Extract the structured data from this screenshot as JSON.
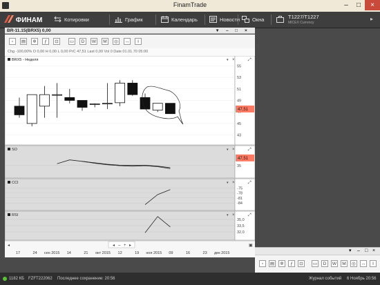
{
  "app": {
    "title": "FinamTrade"
  },
  "colors": {
    "accent": "#e9573f",
    "menubar": "#3e3e3e",
    "price_tag": "#ff7a63"
  },
  "menubar": {
    "logo": "ФИНАМ",
    "items": [
      {
        "label": "Котировки",
        "icon": "quotes-icon"
      },
      {
        "label": "График",
        "icon": "chart-icon"
      },
      {
        "label": "Календарь",
        "icon": "calendar-icon"
      },
      {
        "label": "Новости",
        "icon": "news-icon"
      },
      {
        "label": "Окна",
        "icon": "windows-icon"
      }
    ],
    "account": {
      "name": "T1227/T1227",
      "sub": "MICEX Currency"
    }
  },
  "chart_window": {
    "title": "BR-11.15(BRX5) 0,00",
    "toolbar_buttons": [
      "D",
      "W",
      "M"
    ],
    "info": "Chg -100,00%  O 0,00  H 0,00  L 0,00  PrC 47,51  Last 0,00  Vol 0  Date 01.01.70 05:00"
  },
  "lower_window": {
    "toolbar_buttons": [
      "D",
      "W",
      "M"
    ]
  },
  "chart_data": [
    {
      "type": "candlestick",
      "title": "BRX5 - Неделя",
      "y_ticks": [
        "55",
        "53",
        "51",
        "49",
        "47",
        "45",
        "43"
      ],
      "ylim": [
        42,
        56
      ],
      "last_price_label": "47,51",
      "candles": [
        {
          "o": 48.0,
          "h": 49.5,
          "l": 46.0,
          "c": 46.5
        },
        {
          "o": 45.0,
          "h": 49.5,
          "l": 44.5,
          "c": 50.0
        },
        {
          "o": 48.0,
          "h": 51.5,
          "l": 46.0,
          "c": 50.0
        },
        {
          "o": 50.0,
          "h": 52.0,
          "l": 46.0,
          "c": 50.0
        },
        {
          "o": 49.5,
          "h": 51.0,
          "l": 48.5,
          "c": 49.0
        },
        {
          "o": 49.0,
          "h": 49.0,
          "l": 47.2,
          "c": 47.8
        },
        {
          "o": 48.3,
          "h": 48.5,
          "l": 47.8,
          "c": 48.4
        },
        {
          "o": 48.5,
          "h": 52.0,
          "l": 47.5,
          "c": 48.5
        },
        {
          "o": 48.6,
          "h": 52.5,
          "l": 48.0,
          "c": 52.0
        },
        {
          "o": 52.0,
          "h": 52.5,
          "l": 49.8,
          "c": 50.0
        },
        {
          "o": 49.5,
          "h": 50.2,
          "l": 47.5,
          "c": 47.5
        },
        {
          "o": 47.3,
          "h": 48.5,
          "l": 47.0,
          "c": 48.5
        },
        {
          "o": 48.5,
          "h": 48.5,
          "l": 46.7,
          "c": 46.7
        }
      ]
    },
    {
      "type": "line",
      "title": "SO",
      "y_ticks": [
        "35"
      ],
      "ylim": [
        0,
        100
      ],
      "price_tag": "47,51",
      "series": [
        {
          "values": [
            null,
            null,
            null,
            42,
            58,
            52,
            44,
            38,
            34,
            32,
            34,
            30,
            22
          ]
        },
        {
          "values": [
            null,
            null,
            null,
            null,
            null,
            52,
            46,
            40,
            36,
            36,
            36,
            32,
            26
          ]
        }
      ]
    },
    {
      "type": "line",
      "title": "CCI",
      "y_ticks": [
        "-75",
        "-78",
        "-81",
        "-84"
      ],
      "ylim": [
        -86,
        -72
      ],
      "series": [
        {
          "values": [
            null,
            null,
            null,
            null,
            null,
            null,
            null,
            null,
            null,
            null,
            -85,
            -79,
            -76
          ]
        }
      ]
    },
    {
      "type": "line",
      "title": "RSI",
      "y_ticks": [
        "35,0",
        "33,5",
        "32,0"
      ],
      "ylim": [
        31.0,
        36.0
      ],
      "series": [
        {
          "values": [
            null,
            null,
            null,
            null,
            null,
            null,
            null,
            null,
            null,
            null,
            31.8,
            35.7,
            33.2
          ]
        }
      ]
    }
  ],
  "x_axis_labels": [
    "17",
    "24",
    "сен 2015",
    "14",
    "21",
    "окт 2015",
    "12",
    "19",
    "ноя 2015",
    "09",
    "16",
    "23",
    "дек 2015"
  ],
  "status": {
    "count": "1182 КБ",
    "account": "FZFT222062",
    "saved": "Последнее сохранение: 20:56",
    "journal": "Журнал событий",
    "datetime": "6 Ноябрь 20:56"
  }
}
